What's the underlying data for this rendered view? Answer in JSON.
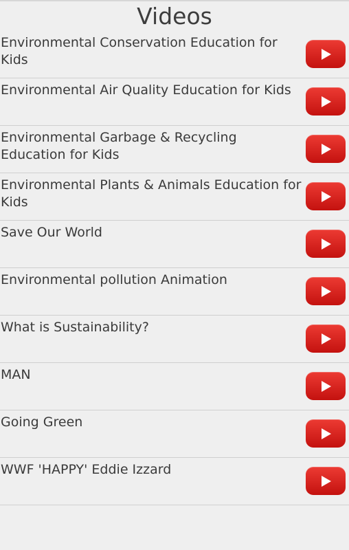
{
  "header": {
    "title": "Videos"
  },
  "videos": [
    {
      "title": "Environmental Conservation Education for Kids"
    },
    {
      "title": "Environmental Air Quality Education for Kids"
    },
    {
      "title": "Environmental Garbage & Recycling Education for Kids"
    },
    {
      "title": "Environmental Plants & Animals Education for Kids"
    },
    {
      "title": "Save Our World"
    },
    {
      "title": "Environmental pollution Animation"
    },
    {
      "title": "What is Sustainability?"
    },
    {
      "title": "MAN"
    },
    {
      "title": "Going Green"
    },
    {
      "title": "WWF 'HAPPY' Eddie Izzard"
    }
  ],
  "icons": {
    "play": "youtube-play-icon"
  },
  "colors": {
    "background": "#efefef",
    "play_button": "#d9221d",
    "divider": "#cfcfcf"
  }
}
